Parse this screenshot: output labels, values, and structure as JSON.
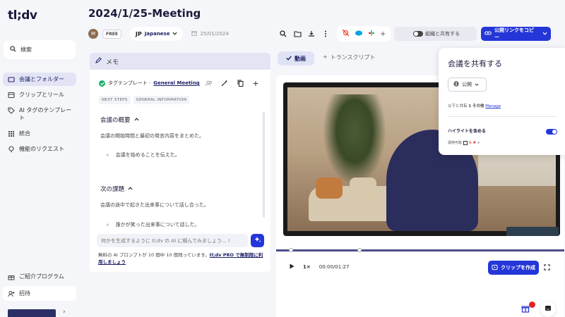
{
  "app": {
    "logo": "tl;dv"
  },
  "sidebar": {
    "search_label": "検索",
    "items": [
      {
        "label": "会議とフォルダー",
        "icon": "meetings-icon",
        "active": true
      },
      {
        "label": "クリップとリール",
        "icon": "clips-icon",
        "active": false
      },
      {
        "label": "AI タグのテンプレート",
        "icon": "tag-icon",
        "active": false
      },
      {
        "label": "統合",
        "icon": "integrations-icon",
        "active": false
      },
      {
        "label": "機能のリクエスト",
        "icon": "lightbulb-icon",
        "active": false
      }
    ],
    "bottom": [
      {
        "label": "ご紹介プログラム",
        "icon": "gift-icon"
      },
      {
        "label": "招待",
        "icon": "invite-icon"
      }
    ]
  },
  "header": {
    "title": "2024/1/25-Meeting",
    "avatar_initial": "M",
    "plan_badge": "FREE",
    "language_code": "JP",
    "language_name": "Japanese",
    "date": "25/01/2024"
  },
  "toolbar": {
    "share_team_label": "組織と共有する",
    "copy_link_label": "公開リンクをコピー"
  },
  "memo": {
    "title": "メモ",
    "template_prefix": "タグテンプレート · ",
    "template_name": "General Meeting",
    "tags": [
      "NEXT STEPS",
      "GENERAL INFORMATION"
    ],
    "sections": [
      {
        "title": "会議の概要",
        "desc": "会議の開始時間と最初の発言内容をまとめた。",
        "item": "会議を始めることを伝えた。"
      },
      {
        "title": "次の課題",
        "desc": "会議の途中で起きた出来事について話し合った。",
        "item": "誰かが笑った出来事について話した。"
      }
    ],
    "prompt_placeholder": "何かを生成するように tl;dv の AI に頼んでみましょう... !",
    "footnote_text": "無料の AI プロンプトが 10 個中 10 個残っています。",
    "footnote_link": "tl;dv PRO で無制限に利用しましょう"
  },
  "tabs": {
    "video": "動画",
    "transcript": "トランスクリプト"
  },
  "player": {
    "speed": "1×",
    "time": "00:00/01:27",
    "clip_label": "クリップを作成",
    "progress": 0.0
  },
  "share_popup": {
    "title": "会議を共有する",
    "visibility": "公開",
    "shared_prefix": "以下と共有 ",
    "shared_count": "1 その他",
    "manage_link": "Manage",
    "highlight_label": "ハイライトを含める",
    "sub_label": "運用可能"
  },
  "colors": {
    "accent": "#2436d8",
    "sidebar_active": "#e2e4f5",
    "memo_header": "#e3e5f4"
  }
}
